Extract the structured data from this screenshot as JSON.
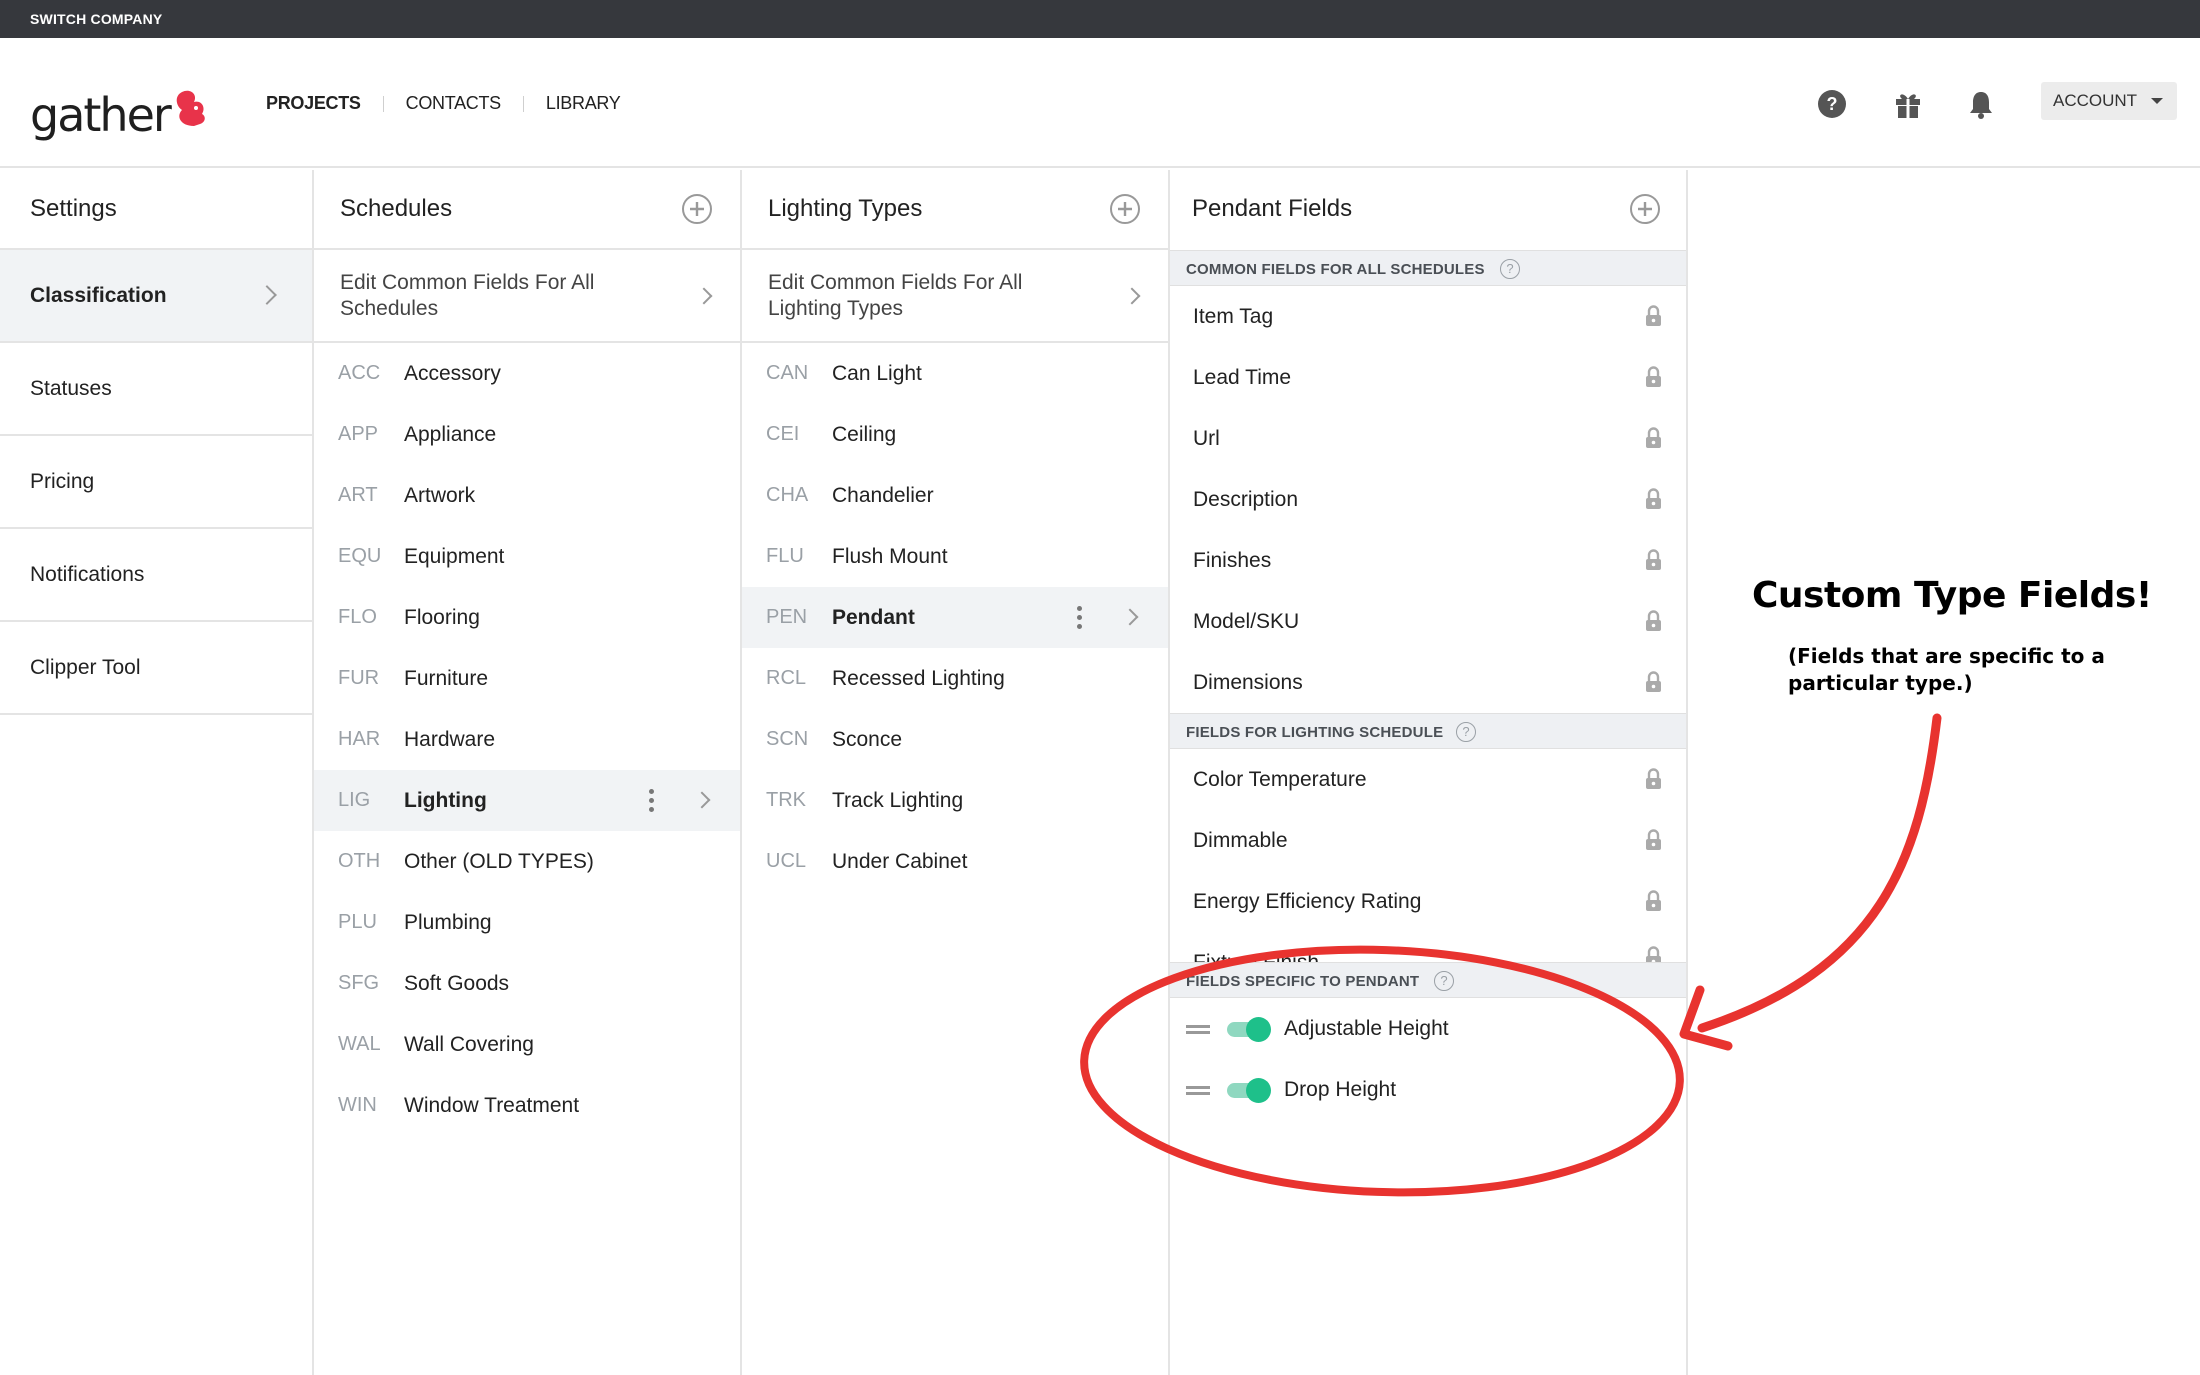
{
  "topbar": {
    "company": "SWITCH COMPANY"
  },
  "header": {
    "logo_text": "gather",
    "nav": [
      {
        "label": "PROJECTS",
        "active": true
      },
      {
        "label": "CONTACTS",
        "active": false
      },
      {
        "label": "LIBRARY",
        "active": false
      }
    ],
    "icons": [
      "help-icon",
      "gift-icon",
      "bell-icon"
    ],
    "account_label": "ACCOUNT"
  },
  "settings": {
    "title": "Settings",
    "items": [
      {
        "label": "Classification",
        "active": true
      },
      {
        "label": "Statuses"
      },
      {
        "label": "Pricing"
      },
      {
        "label": "Notifications"
      },
      {
        "label": "Clipper Tool"
      }
    ]
  },
  "schedules": {
    "title": "Schedules",
    "edit_common": "Edit Common Fields For All Schedules",
    "items": [
      {
        "code": "ACC",
        "name": "Accessory"
      },
      {
        "code": "APP",
        "name": "Appliance"
      },
      {
        "code": "ART",
        "name": "Artwork"
      },
      {
        "code": "EQU",
        "name": "Equipment"
      },
      {
        "code": "FLO",
        "name": "Flooring"
      },
      {
        "code": "FUR",
        "name": "Furniture"
      },
      {
        "code": "HAR",
        "name": "Hardware"
      },
      {
        "code": "LIG",
        "name": "Lighting",
        "active": true
      },
      {
        "code": "OTH",
        "name": "Other (OLD TYPES)"
      },
      {
        "code": "PLU",
        "name": "Plumbing"
      },
      {
        "code": "SFG",
        "name": "Soft Goods"
      },
      {
        "code": "WAL",
        "name": "Wall Covering"
      },
      {
        "code": "WIN",
        "name": "Window Treatment"
      }
    ]
  },
  "lighting_types": {
    "title": "Lighting Types",
    "edit_common": "Edit Common Fields For All Lighting Types",
    "items": [
      {
        "code": "CAN",
        "name": "Can Light"
      },
      {
        "code": "CEI",
        "name": "Ceiling"
      },
      {
        "code": "CHA",
        "name": "Chandelier"
      },
      {
        "code": "FLU",
        "name": "Flush Mount"
      },
      {
        "code": "PEN",
        "name": "Pendant",
        "active": true
      },
      {
        "code": "RCL",
        "name": "Recessed Lighting"
      },
      {
        "code": "SCN",
        "name": "Sconce"
      },
      {
        "code": "TRK",
        "name": "Track Lighting"
      },
      {
        "code": "UCL",
        "name": "Under Cabinet"
      }
    ]
  },
  "pendant_fields": {
    "title": "Pendant Fields",
    "common_header": "COMMON FIELDS FOR ALL SCHEDULES",
    "common_fields": [
      "Item Tag",
      "Lead Time",
      "Url",
      "Description",
      "Finishes",
      "Model/SKU",
      "Dimensions"
    ],
    "schedule_header": "FIELDS FOR LIGHTING SCHEDULE",
    "schedule_fields": [
      "Color Temperature",
      "Dimmable",
      "Energy Efficiency Rating",
      "Fixture Finish"
    ],
    "specific_header": "FIELDS SPECIFIC TO PENDANT",
    "specific_fields": [
      {
        "name": "Adjustable Height",
        "enabled": true
      },
      {
        "name": "Drop Height",
        "enabled": true
      }
    ]
  },
  "annotation": {
    "title": "Custom Type Fields!",
    "subtitle": "(Fields that are specific to a particular type.)",
    "color": "#e8332f"
  },
  "colors": {
    "toggle_on": "#1ec08a",
    "logo_accent": "#e8334a",
    "topbar": "#36383d"
  }
}
